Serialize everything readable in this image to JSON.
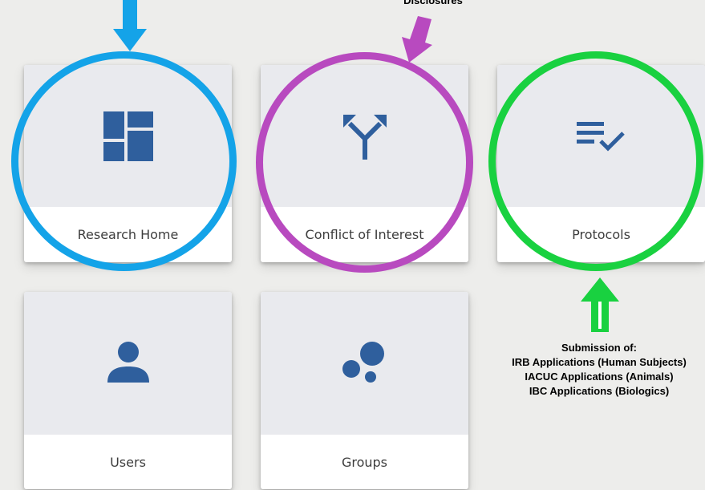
{
  "tiles": [
    {
      "label": "Research Home",
      "icon": "dashboard-icon"
    },
    {
      "label": "Conflict of Interest",
      "icon": "merge-arrows-icon"
    },
    {
      "label": "Protocols",
      "icon": "checklist-icon"
    },
    {
      "label": "Users",
      "icon": "person-icon"
    },
    {
      "label": "Groups",
      "icon": "bubbles-icon"
    }
  ],
  "annotations": {
    "disclosures": "Disclosures",
    "submission": {
      "heading": "Submission of:",
      "lines": [
        "IRB Applications (Human Subjects)",
        "IACUC Applications (Animals)",
        "IBC Applications (Biologics)"
      ]
    }
  },
  "colors": {
    "icon": "#2f5f9d",
    "blue_ring": "#14a3e8",
    "purple_ring": "#b84abf",
    "green_ring": "#19d140",
    "tile_icon_bg": "#e9eaee"
  }
}
